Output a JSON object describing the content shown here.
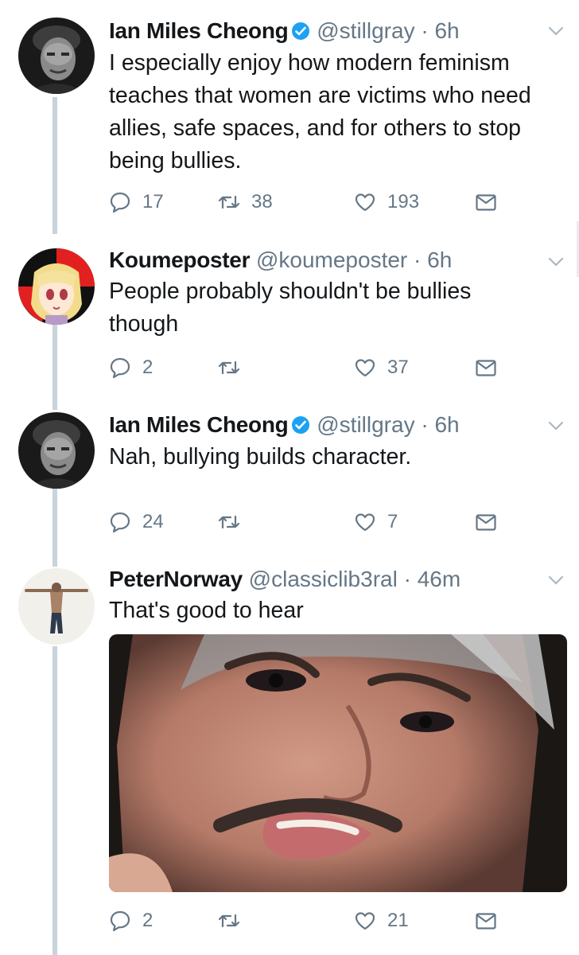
{
  "colors": {
    "text": "#14171a",
    "muted": "#657786",
    "verified": "#1da1f2",
    "thread_line": "#c9d3dc"
  },
  "tweets": [
    {
      "name": "Ian Miles Cheong",
      "verified": true,
      "handle": "@stillgray",
      "separator": "·",
      "time": "6h",
      "text": "I especially enjoy how modern feminism teaches that women are victims who need allies, safe spaces, and for others to stop being bullies.",
      "replies": "17",
      "retweets": "38",
      "likes": "193",
      "avatar_icon": "avatar-photo-bw-man"
    },
    {
      "name": "Koumeposter",
      "verified": false,
      "handle": "@koumeposter",
      "separator": "·",
      "time": "6h",
      "text": "People probably shouldn't be bullies though",
      "replies": "2",
      "retweets": "",
      "likes": "37",
      "avatar_icon": "avatar-anime-girl"
    },
    {
      "name": "Ian Miles Cheong",
      "verified": true,
      "handle": "@stillgray",
      "separator": "·",
      "time": "6h",
      "text": "Nah, bullying builds character.",
      "replies": "24",
      "retweets": "",
      "likes": "7",
      "avatar_icon": "avatar-photo-bw-man"
    },
    {
      "name": "PeterNorway",
      "verified": false,
      "handle": "@classiclib3ral",
      "separator": "·",
      "time": "46m",
      "text": "That's good to hear",
      "replies": "2",
      "retweets": "",
      "likes": "21",
      "avatar_icon": "avatar-man-arms-outstretched",
      "media_icon": "photo-closeup-face"
    }
  ]
}
